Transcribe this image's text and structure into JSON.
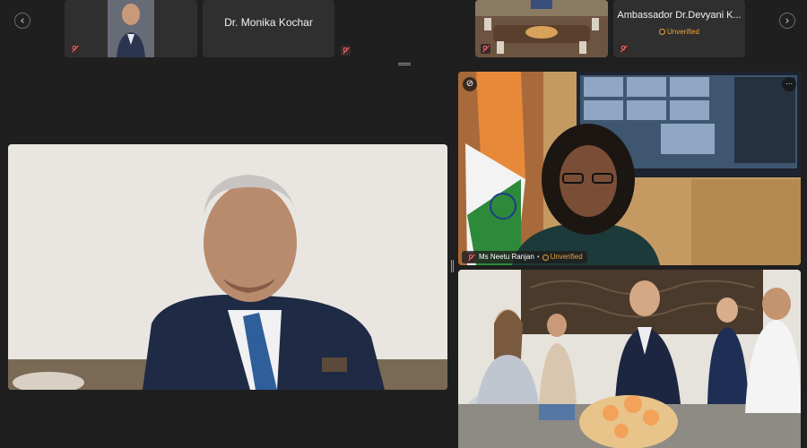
{
  "strip": {
    "prev_glyph": "‹",
    "next_glyph": "›",
    "participants": [
      {
        "name": "Dr. Monika Kochar",
        "muted": true
      },
      {
        "name": "Ambassador Dr.Devyani K...",
        "status": "Unverified",
        "muted": true
      }
    ]
  },
  "main": {
    "tiles": [
      {
        "role": "large-speaker",
        "muted": false
      },
      {
        "name": "Ms Neetu Ranjan",
        "status": "Unverified",
        "muted": true,
        "pin_glyph": "⊘",
        "more_glyph": "···"
      },
      {
        "role": "group-room",
        "muted": false
      }
    ]
  },
  "colors": {
    "background": "#1f1f1f",
    "tile": "#2f2f2f",
    "unverified": "#e8a33a",
    "muted": "#e66666"
  }
}
